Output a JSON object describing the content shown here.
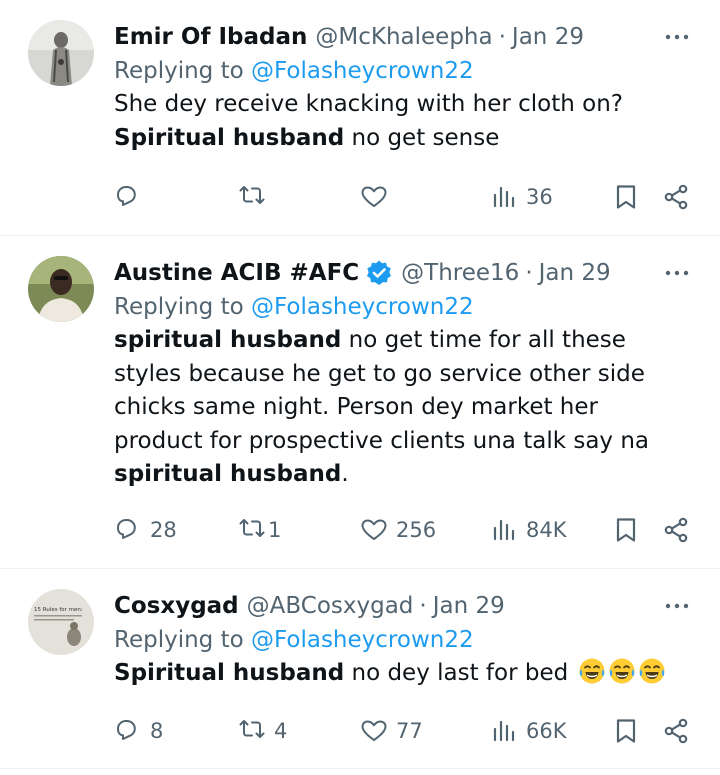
{
  "tweets": [
    {
      "name": "Emir Of Ibadan",
      "handle": "@McKhaleepha",
      "dot": "·",
      "date": "Jan 29",
      "replying_prefix": "Replying to ",
      "replying_to": "@Folasheycrown22",
      "text_line1": "She dey receive knacking with her cloth on?",
      "bold2": "Spiritual husband",
      "rest2": " no get sense",
      "replies": "",
      "retweets": "",
      "likes": "",
      "views": "36"
    },
    {
      "name": "Austine ACIB #AFC",
      "handle": "@Three16",
      "dot": "·",
      "date": "Jan 29",
      "verified": true,
      "replying_prefix": "Replying to ",
      "replying_to": "@Folasheycrown22",
      "bold1": "spiritual husband",
      "text1": " no get time for all these styles because he get to go service other side chicks same night. Person dey market her product for prospective clients una talk say na ",
      "bold2": "spiritual husband",
      "text2": ".",
      "replies": "28",
      "retweets": "1",
      "likes": "256",
      "views": "84K"
    },
    {
      "name": "Cosxygad",
      "handle": "@ABCosxygad",
      "dot": "·",
      "date": "Jan 29",
      "avatar_text": "15 Rules for men:",
      "replying_prefix": "Replying to ",
      "replying_to": "@Folasheycrown22",
      "bold1": "Spiritual husband",
      "text1": " no dey last for bed ",
      "replies": "8",
      "retweets": "4",
      "likes": "77",
      "views": "66K"
    }
  ],
  "colors": {
    "text": "#0f1419",
    "secondary": "#536471",
    "link": "#1d9bf0",
    "divider": "#eff3f4"
  },
  "icons": [
    "more-icon",
    "reply-icon",
    "retweet-icon",
    "like-icon",
    "views-icon",
    "bookmark-icon",
    "share-icon",
    "verified-icon",
    "tears-of-joy-emoji"
  ]
}
